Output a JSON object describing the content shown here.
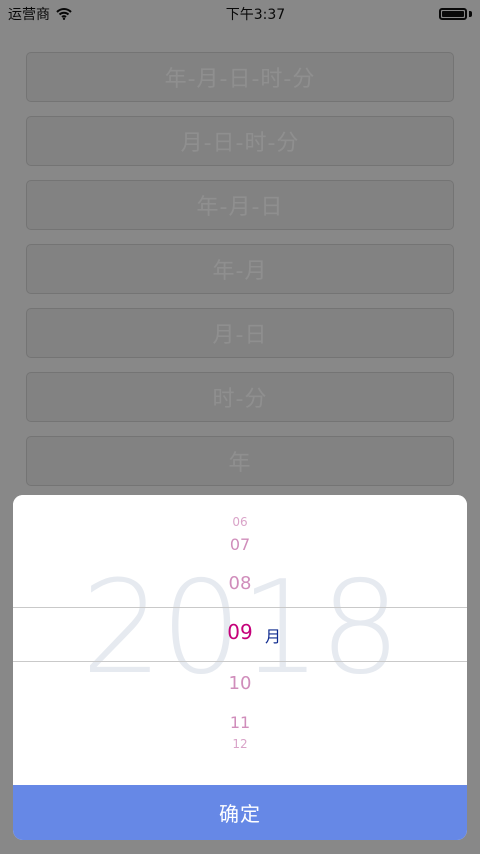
{
  "status_bar": {
    "carrier": "运营商",
    "time": "下午3:37"
  },
  "options": [
    {
      "label": "年-月-日-时-分"
    },
    {
      "label": "月-日-时-分"
    },
    {
      "label": "年-月-日"
    },
    {
      "label": "年-月"
    },
    {
      "label": "月-日"
    },
    {
      "label": "时-分"
    },
    {
      "label": "年"
    }
  ],
  "picker": {
    "year_watermark": "2018",
    "month_values": [
      "06",
      "07",
      "08",
      "09",
      "10",
      "11",
      "12"
    ],
    "selected_month": "09",
    "unit": "月",
    "confirm_label": "确定"
  },
  "colors": {
    "button_bg": "#e8e8e8",
    "overlay": "#000000",
    "confirm_bg": "#6688e6",
    "selected_text": "#c5007a",
    "unit_text": "#0f2b8f",
    "wheel_text": "#d08dbb",
    "watermark": "#e6eaf0"
  }
}
